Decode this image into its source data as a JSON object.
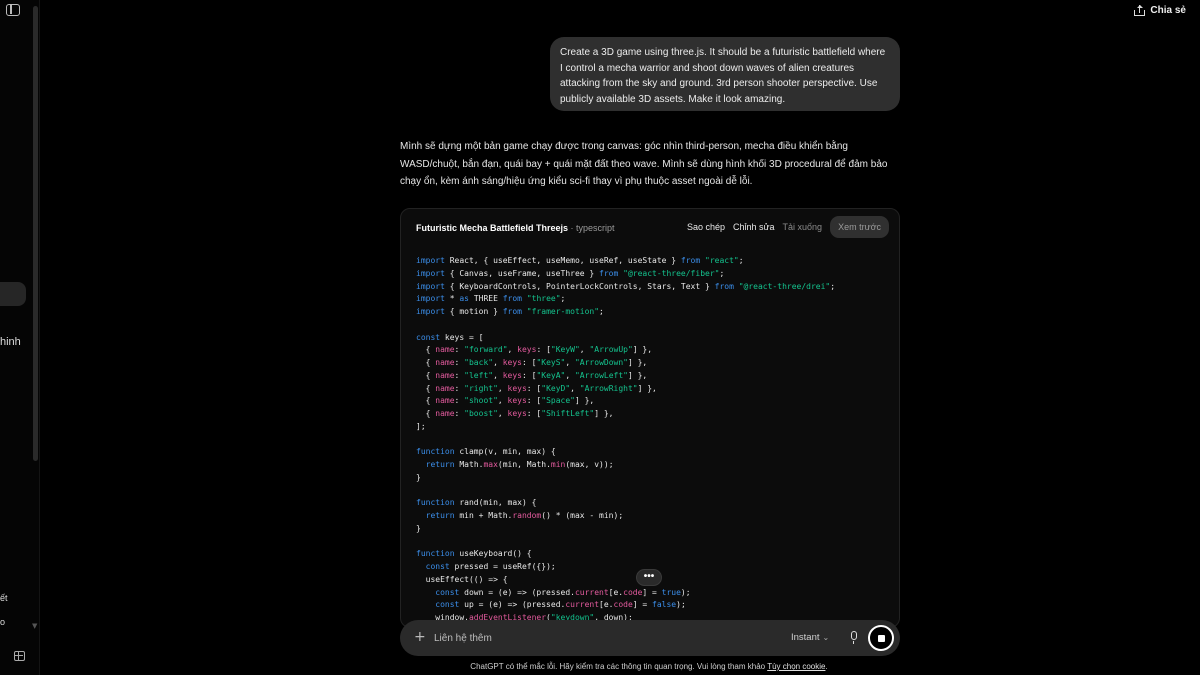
{
  "sidebar": {
    "partial_items": [
      "hinh",
      "ết",
      "o"
    ]
  },
  "header": {
    "share_label": "Chia sẻ"
  },
  "user_message": "Create a 3D game using three.js. It should be a futuristic battlefield where I control a mecha warrior and shoot down waves of alien creatures attacking from the sky and ground. 3rd person shooter perspective. Use publicly available 3D assets. Make it look amazing.",
  "assistant_message": "Mình sẽ dựng một bản game chạy được trong canvas: góc nhìn third-person, mecha điều khiển bằng WASD/chuột, bắn đạn, quái bay + quái mặt đất theo wave. Mình sẽ dùng hình khối 3D procedural để đảm bảo chạy ổn, kèm ánh sáng/hiệu ứng kiểu sci-fi thay vì phụ thuộc asset ngoài dễ lỗi.",
  "code_block": {
    "title": "Futuristic Mecha Battlefield Threejs",
    "language": "typescript",
    "actions": {
      "copy": "Sao chép",
      "edit": "Chỉnh sửa",
      "download": "Tải xuống",
      "preview": "Xem trước"
    },
    "lines": [
      [
        [
          "k",
          "import"
        ],
        [
          "f",
          " React, { useEffect, useMemo, useRef, useState } "
        ],
        [
          "k",
          "from"
        ],
        [
          "f",
          " "
        ],
        [
          "s",
          "\"react\""
        ],
        [
          "f",
          ";"
        ]
      ],
      [
        [
          "k",
          "import"
        ],
        [
          "f",
          " { Canvas, useFrame, useThree } "
        ],
        [
          "k",
          "from"
        ],
        [
          "f",
          " "
        ],
        [
          "s",
          "\"@react-three/fiber\""
        ],
        [
          "f",
          ";"
        ]
      ],
      [
        [
          "k",
          "import"
        ],
        [
          "f",
          " { KeyboardControls, PointerLockControls, Stars, Text } "
        ],
        [
          "k",
          "from"
        ],
        [
          "f",
          " "
        ],
        [
          "s",
          "\"@react-three/drei\""
        ],
        [
          "f",
          ";"
        ]
      ],
      [
        [
          "k",
          "import"
        ],
        [
          "f",
          " * "
        ],
        [
          "k",
          "as"
        ],
        [
          "f",
          " THREE "
        ],
        [
          "k",
          "from"
        ],
        [
          "f",
          " "
        ],
        [
          "s",
          "\"three\""
        ],
        [
          "f",
          ";"
        ]
      ],
      [
        [
          "k",
          "import"
        ],
        [
          "f",
          " { motion } "
        ],
        [
          "k",
          "from"
        ],
        [
          "f",
          " "
        ],
        [
          "s",
          "\"framer-motion\""
        ],
        [
          "f",
          ";"
        ]
      ],
      [
        [
          "f",
          ""
        ]
      ],
      [
        [
          "k",
          "const"
        ],
        [
          "f",
          " keys = ["
        ]
      ],
      [
        [
          "f",
          "  { "
        ],
        [
          "p",
          "name"
        ],
        [
          "f",
          ": "
        ],
        [
          "s",
          "\"forward\""
        ],
        [
          "f",
          ", "
        ],
        [
          "p",
          "keys"
        ],
        [
          "f",
          ": ["
        ],
        [
          "s",
          "\"KeyW\""
        ],
        [
          "f",
          ", "
        ],
        [
          "s",
          "\"ArrowUp\""
        ],
        [
          "f",
          "] },"
        ]
      ],
      [
        [
          "f",
          "  { "
        ],
        [
          "p",
          "name"
        ],
        [
          "f",
          ": "
        ],
        [
          "s",
          "\"back\""
        ],
        [
          "f",
          ", "
        ],
        [
          "p",
          "keys"
        ],
        [
          "f",
          ": ["
        ],
        [
          "s",
          "\"KeyS\""
        ],
        [
          "f",
          ", "
        ],
        [
          "s",
          "\"ArrowDown\""
        ],
        [
          "f",
          "] },"
        ]
      ],
      [
        [
          "f",
          "  { "
        ],
        [
          "p",
          "name"
        ],
        [
          "f",
          ": "
        ],
        [
          "s",
          "\"left\""
        ],
        [
          "f",
          ", "
        ],
        [
          "p",
          "keys"
        ],
        [
          "f",
          ": ["
        ],
        [
          "s",
          "\"KeyA\""
        ],
        [
          "f",
          ", "
        ],
        [
          "s",
          "\"ArrowLeft\""
        ],
        [
          "f",
          "] },"
        ]
      ],
      [
        [
          "f",
          "  { "
        ],
        [
          "p",
          "name"
        ],
        [
          "f",
          ": "
        ],
        [
          "s",
          "\"right\""
        ],
        [
          "f",
          ", "
        ],
        [
          "p",
          "keys"
        ],
        [
          "f",
          ": ["
        ],
        [
          "s",
          "\"KeyD\""
        ],
        [
          "f",
          ", "
        ],
        [
          "s",
          "\"ArrowRight\""
        ],
        [
          "f",
          "] },"
        ]
      ],
      [
        [
          "f",
          "  { "
        ],
        [
          "p",
          "name"
        ],
        [
          "f",
          ": "
        ],
        [
          "s",
          "\"shoot\""
        ],
        [
          "f",
          ", "
        ],
        [
          "p",
          "keys"
        ],
        [
          "f",
          ": ["
        ],
        [
          "s",
          "\"Space\""
        ],
        [
          "f",
          "] },"
        ]
      ],
      [
        [
          "f",
          "  { "
        ],
        [
          "p",
          "name"
        ],
        [
          "f",
          ": "
        ],
        [
          "s",
          "\"boost\""
        ],
        [
          "f",
          ", "
        ],
        [
          "p",
          "keys"
        ],
        [
          "f",
          ": ["
        ],
        [
          "s",
          "\"ShiftLeft\""
        ],
        [
          "f",
          "] },"
        ]
      ],
      [
        [
          "f",
          "];"
        ]
      ],
      [
        [
          "f",
          ""
        ]
      ],
      [
        [
          "k",
          "function"
        ],
        [
          "f",
          " clamp(v, min, max) {"
        ]
      ],
      [
        [
          "f",
          "  "
        ],
        [
          "k",
          "return"
        ],
        [
          "f",
          " Math."
        ],
        [
          "p",
          "max"
        ],
        [
          "f",
          "(min, Math."
        ],
        [
          "p",
          "min"
        ],
        [
          "f",
          "(max, v));"
        ]
      ],
      [
        [
          "f",
          "}"
        ]
      ],
      [
        [
          "f",
          ""
        ]
      ],
      [
        [
          "k",
          "function"
        ],
        [
          "f",
          " rand(min, max) {"
        ]
      ],
      [
        [
          "f",
          "  "
        ],
        [
          "k",
          "return"
        ],
        [
          "f",
          " min + Math."
        ],
        [
          "p",
          "random"
        ],
        [
          "f",
          "() * (max - min);"
        ]
      ],
      [
        [
          "f",
          "}"
        ]
      ],
      [
        [
          "f",
          ""
        ]
      ],
      [
        [
          "k",
          "function"
        ],
        [
          "f",
          " useKeyboard() {"
        ]
      ],
      [
        [
          "f",
          "  "
        ],
        [
          "k",
          "const"
        ],
        [
          "f",
          " pressed = useRef({});"
        ]
      ],
      [
        [
          "f",
          "  useEffect(() => {"
        ]
      ],
      [
        [
          "f",
          "    "
        ],
        [
          "k",
          "const"
        ],
        [
          "f",
          " down = (e) => (pressed."
        ],
        [
          "p",
          "current"
        ],
        [
          "f",
          "[e."
        ],
        [
          "p",
          "code"
        ],
        [
          "f",
          "] = "
        ],
        [
          "k",
          "true"
        ],
        [
          "f",
          ");"
        ]
      ],
      [
        [
          "f",
          "    "
        ],
        [
          "k",
          "const"
        ],
        [
          "f",
          " up = (e) => (pressed."
        ],
        [
          "p",
          "current"
        ],
        [
          "f",
          "[e."
        ],
        [
          "p",
          "code"
        ],
        [
          "f",
          "] = "
        ],
        [
          "k",
          "false"
        ],
        [
          "f",
          ");"
        ]
      ],
      [
        [
          "f",
          "    window."
        ],
        [
          "p",
          "addEventListener"
        ],
        [
          "f",
          "("
        ],
        [
          "s",
          "\"keydown\""
        ],
        [
          "f",
          ", down);"
        ]
      ]
    ]
  },
  "more_label": "•••",
  "composer": {
    "plus": "+",
    "placeholder": "Liên hệ thêm",
    "model": "Instant"
  },
  "disclaimer": {
    "text": "ChatGPT có thể mắc lỗi. Hãy kiểm tra các thông tin quan trọng. Vui lòng tham khảo ",
    "link": "Tùy chọn cookie",
    "end": "."
  }
}
